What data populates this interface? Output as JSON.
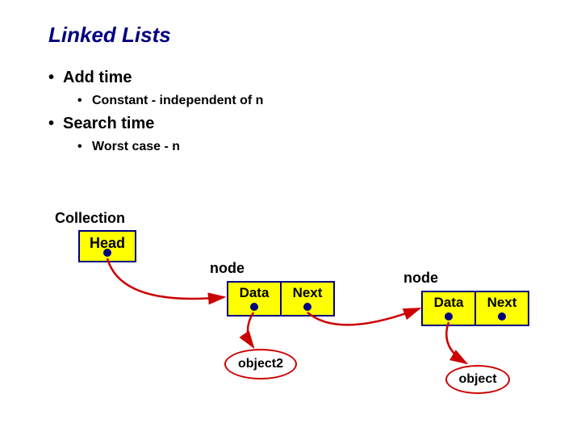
{
  "title": "Linked Lists",
  "bullets": {
    "b1a": "Add time",
    "b2a": "Constant - independent of n",
    "b1b": "Search time",
    "b2b": "Worst case - n"
  },
  "diagram": {
    "collection_label": "Collection",
    "head_label": "Head",
    "node1_label": "node",
    "node2_label": "node",
    "data_label": "Data",
    "next_label": "Next",
    "object2_label": "object2",
    "object_label": "object"
  }
}
